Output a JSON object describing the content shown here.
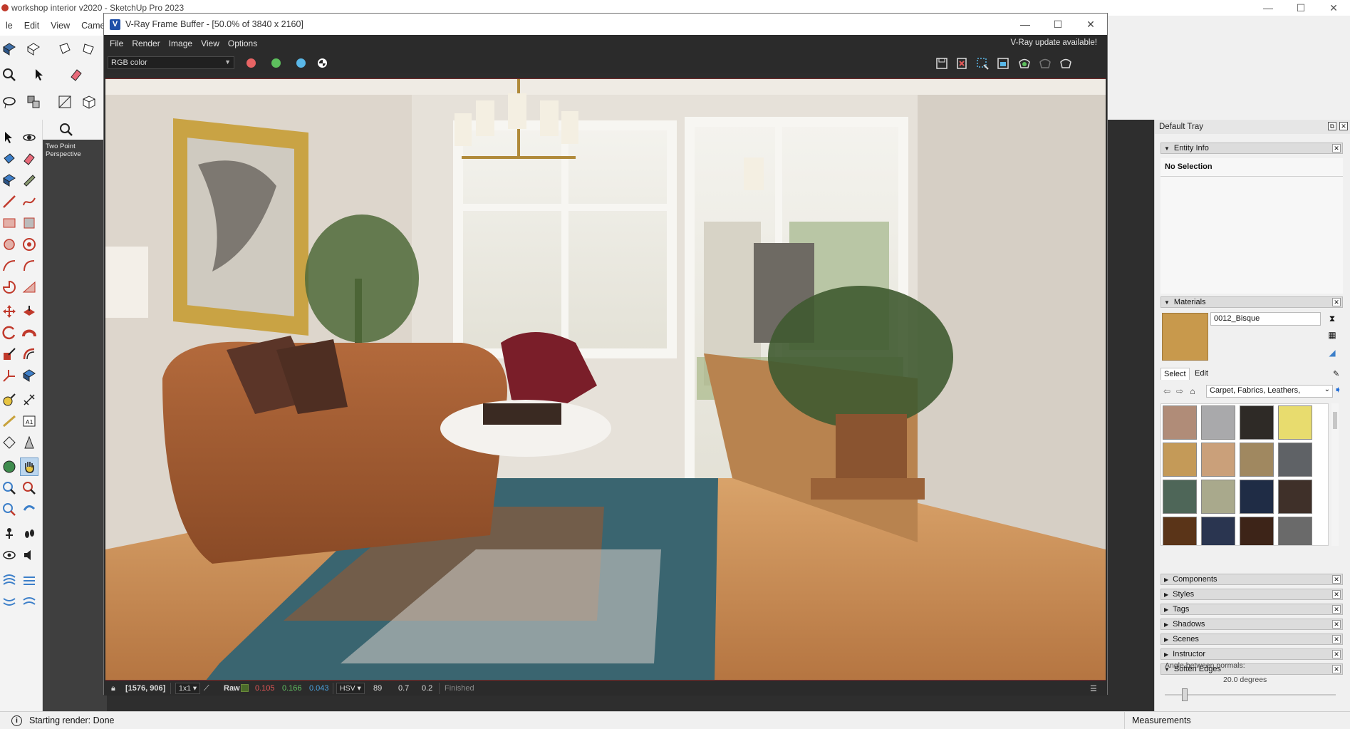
{
  "sketchup": {
    "title": "workshop interior v2020 - SketchUp Pro 2023",
    "menu": [
      "le",
      "Edit",
      "View",
      "Camer"
    ],
    "window_controls": [
      "—",
      "☐",
      "✕"
    ],
    "viewport_label": "Two Point\nPerspective",
    "status_text": "Starting render: Done",
    "measurements_label": "Measurements"
  },
  "vfb": {
    "title": "V-Ray Frame Buffer - [50.0% of 3840 x 2160]",
    "menu": [
      "File",
      "Render",
      "Image",
      "View",
      "Options"
    ],
    "update_notice": "V-Ray update available!",
    "channel": "RGB color",
    "channel_dots": [
      {
        "name": "red-channel-toggle",
        "color": "#e86464"
      },
      {
        "name": "green-channel-toggle",
        "color": "#5dc05d"
      },
      {
        "name": "blue-channel-toggle",
        "color": "#5ab8e8"
      }
    ],
    "status": {
      "coords": "[1576, 906]",
      "zoom": "1x1",
      "mode": "Raw",
      "r": "0.105",
      "g": "0.166",
      "b": "0.043",
      "color_space": "HSV",
      "h": "89",
      "s": "0.7",
      "v": "0.2",
      "state": "Finished"
    },
    "colors": {
      "r": "#e35757",
      "g": "#63c263",
      "b": "#4aa3e0"
    }
  },
  "tray": {
    "title": "Default Tray",
    "entity_info": {
      "title": "Entity Info",
      "selection": "No Selection"
    },
    "materials": {
      "title": "Materials",
      "name": "0012_Bisque",
      "swatch_color": "#c8994c",
      "tabs": [
        "Select",
        "Edit"
      ],
      "library": "Carpet, Fabrics, Leathers,",
      "swatches": [
        "#b08c78",
        "#a9a9ab",
        "#2e2a26",
        "#e8dc6e",
        "#c49a58",
        "#caa07a",
        "#a08860",
        "#5f6266",
        "#4e6658",
        "#a9a98c",
        "#1f2c45",
        "#3f3029",
        "#5a3418",
        "#2a3550",
        "#3d2418",
        "#6a6a6a"
      ]
    },
    "panels": [
      "Components",
      "Styles",
      "Tags",
      "Shadows",
      "Scenes",
      "Instructor",
      "Soften Edges"
    ],
    "soften": {
      "label": "Angle between normals:",
      "value": "20.0  degrees"
    }
  }
}
